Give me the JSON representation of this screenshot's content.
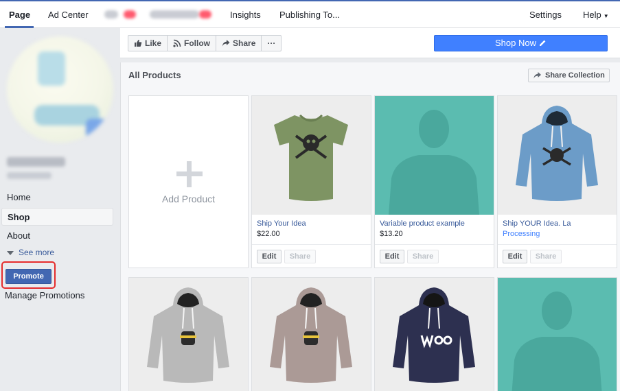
{
  "topnav": {
    "tabs": [
      {
        "label": "Page",
        "active": true
      },
      {
        "label": "Ad Center"
      },
      {
        "label": "Insights"
      },
      {
        "label": "Publishing To..."
      }
    ],
    "settings": "Settings",
    "help": "Help"
  },
  "sidebar": {
    "items": [
      {
        "label": "Home"
      },
      {
        "label": "Shop",
        "active": true
      },
      {
        "label": "About"
      }
    ],
    "see_more": "See more",
    "promote": "Promote",
    "manage_promotions": "Manage Promotions"
  },
  "actionbar": {
    "like": "Like",
    "follow": "Follow",
    "share": "Share",
    "more": "···",
    "shop_now": "Shop Now"
  },
  "products": {
    "section_title": "All Products",
    "share_collection": "Share Collection",
    "add_product": "Add Product",
    "edit_label": "Edit",
    "share_label": "Share",
    "items": [
      {
        "title": "Ship Your Idea",
        "price": "$22.00",
        "image": "green-skull-tshirt"
      },
      {
        "title": "Variable product example",
        "price": "$13.20",
        "image": "placeholder-silhouette"
      },
      {
        "title": "Ship YOUR Idea. La",
        "price": "Processing",
        "image": "blue-skull-hoodie"
      }
    ],
    "row2_images": [
      "grey-ninja-hoodie",
      "mauve-ninja-hoodie",
      "navy-woo-hoodie",
      "placeholder-silhouette"
    ]
  },
  "colors": {
    "accent": "#4267b2",
    "shop_now": "#4080ff",
    "placeholder_teal": "#5bbcb0",
    "highlight": "#e52b2b"
  }
}
